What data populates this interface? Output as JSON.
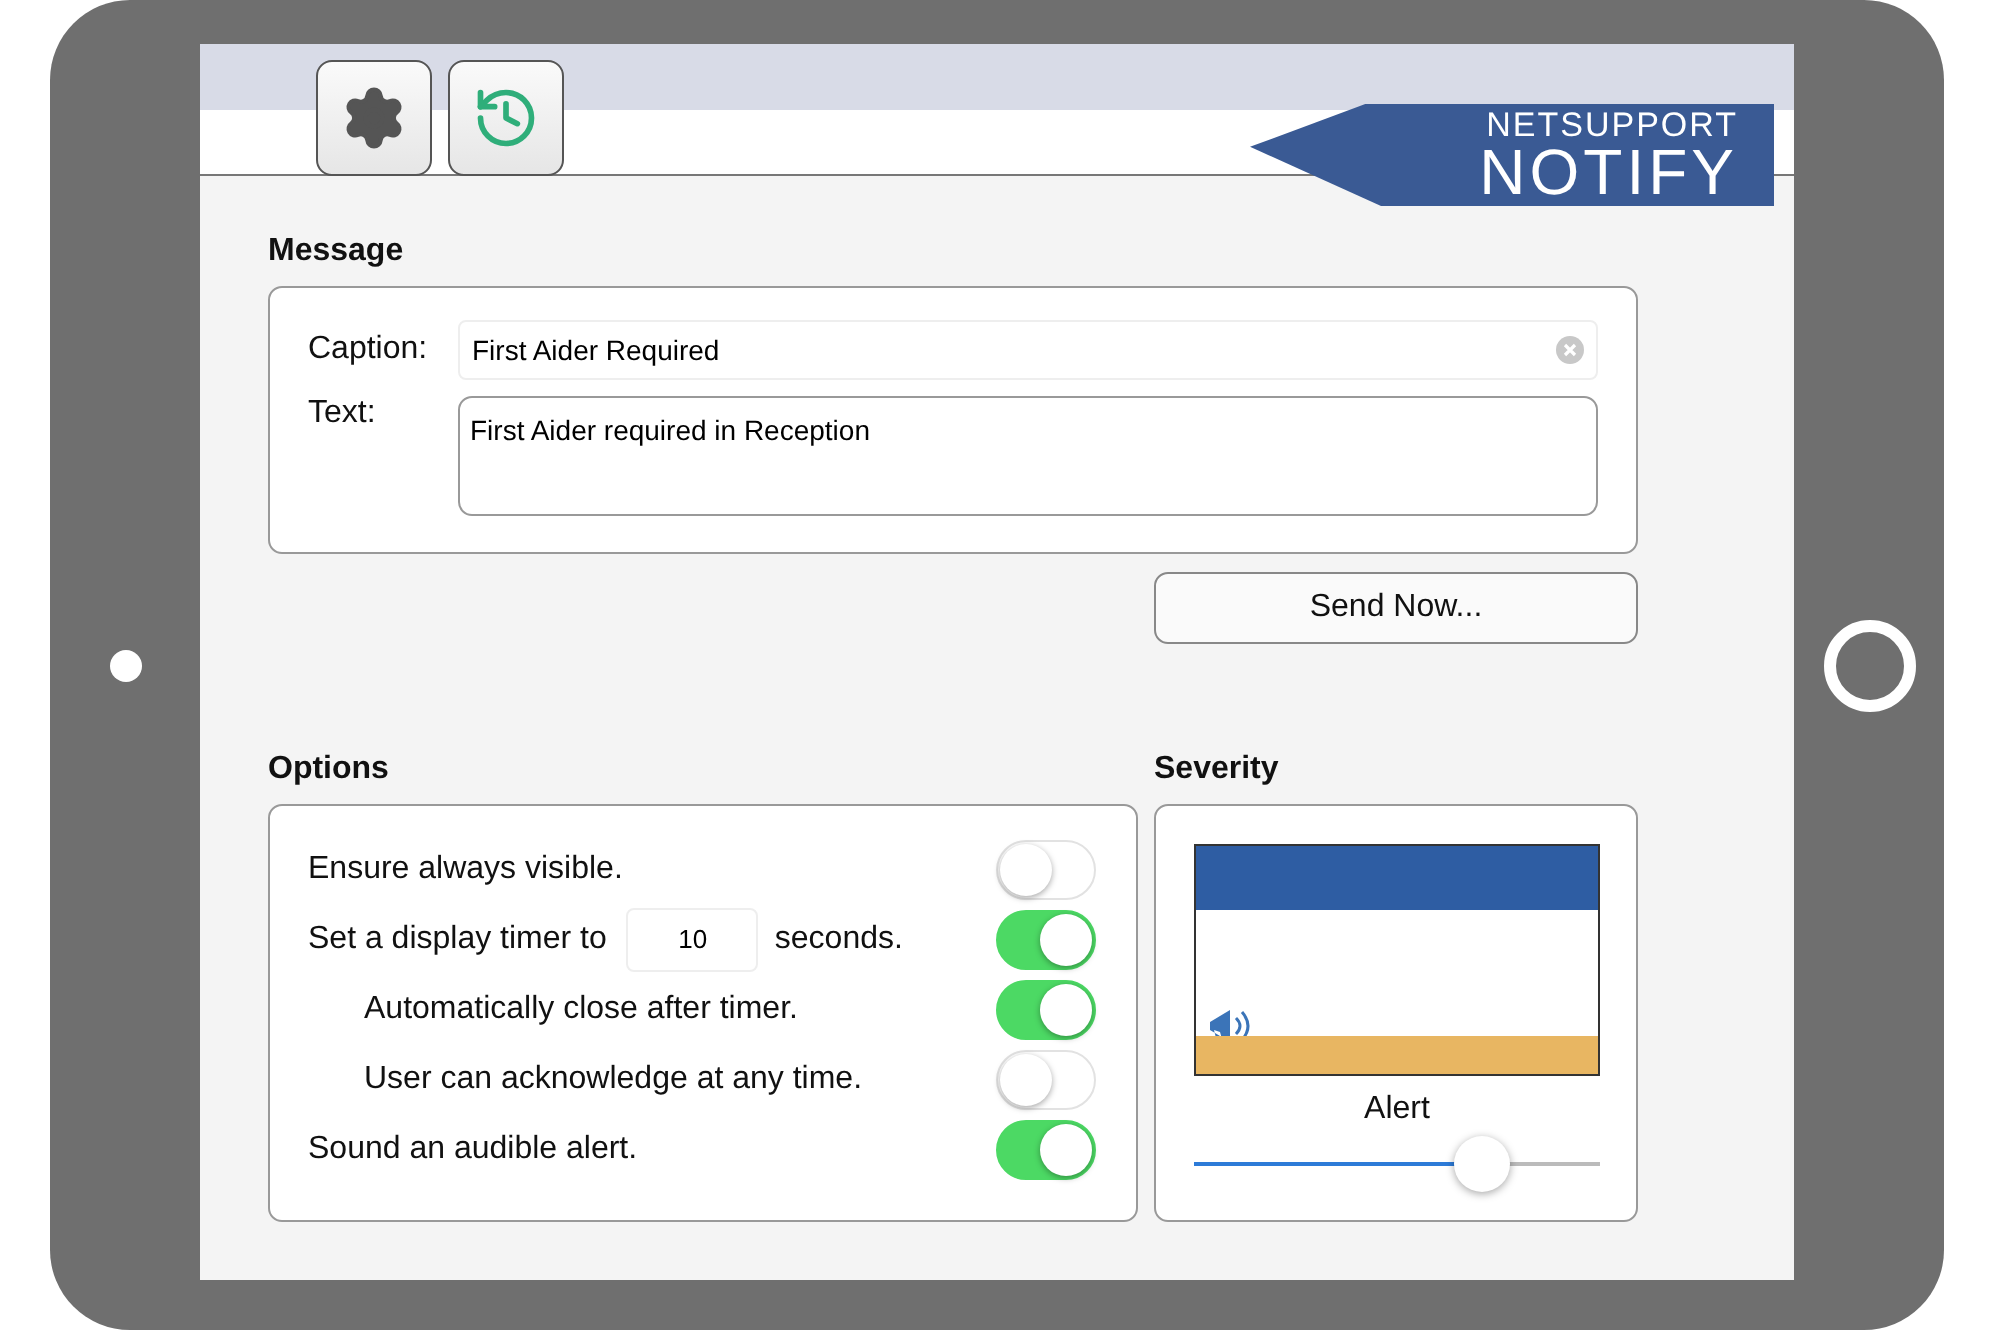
{
  "toolbar": {
    "buttons": [
      {
        "kind": "settings"
      },
      {
        "kind": "history"
      }
    ]
  },
  "logo": {
    "line_1": "NETSUPPORT",
    "line_2": "NOTIFY"
  },
  "message": {
    "title": "Message",
    "caption": {
      "label": "Caption:",
      "value": "First Aider Required"
    },
    "text": {
      "label": "Text:",
      "value": "First Aider required in Reception"
    },
    "send_button": "Send Now..."
  },
  "options": {
    "title": "Options",
    "items": [
      {
        "kind": "plain",
        "label": "Ensure always visible.",
        "on": false
      },
      {
        "kind": "timer",
        "label": "Set a display timer to",
        "value": "10",
        "suffix": "seconds.",
        "on": true,
        "children": [
          {
            "kind": "plain",
            "label": "Automatically close after timer.",
            "on": true
          },
          {
            "kind": "plain",
            "label": "User can acknowledge at any time.",
            "on": false
          }
        ]
      },
      {
        "kind": "plain",
        "label": "Sound an audible alert.",
        "on": true
      }
    ]
  },
  "severity": {
    "title": "Severity",
    "level_name": "Alert",
    "level": 0.71
  }
}
